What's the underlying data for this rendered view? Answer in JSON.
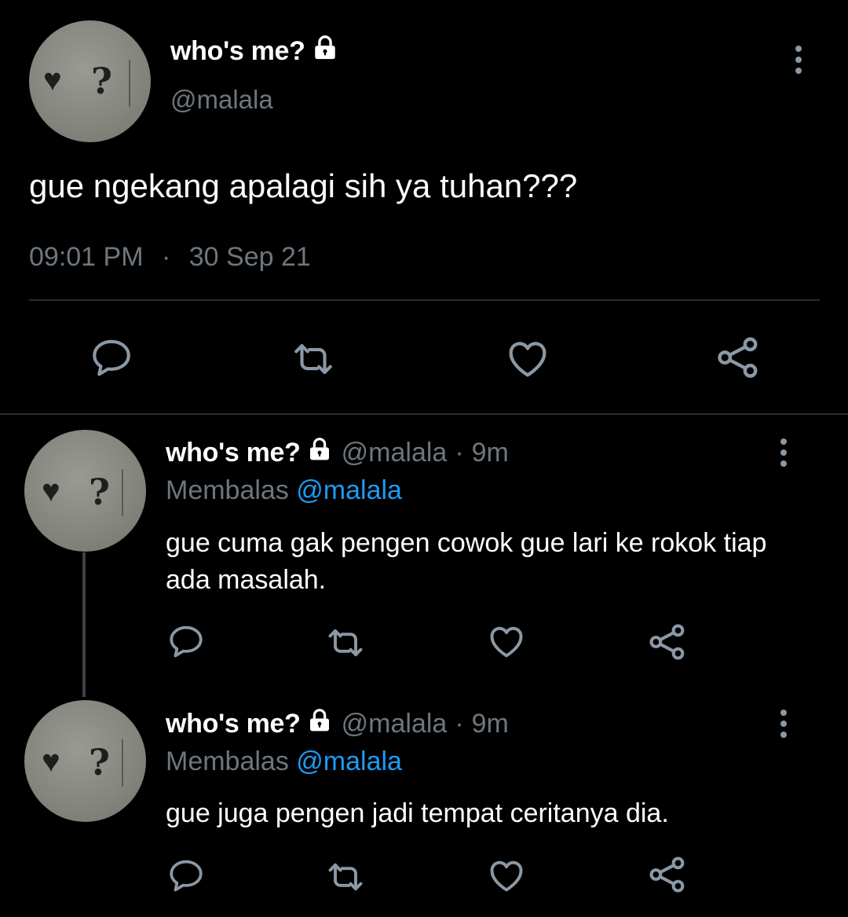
{
  "main_tweet": {
    "display_name": "who's me?",
    "handle": "@malala",
    "text": "gue ngekang apalagi sih ya tuhan???",
    "time": "09:01 PM",
    "separator": "·",
    "date": "30 Sep 21",
    "avatar_glyphs": {
      "heart": "♥",
      "question": "?"
    }
  },
  "replies": [
    {
      "display_name": "who's me?",
      "handle": "@malala",
      "dot": "·",
      "time": "9m",
      "replying_prefix": "Membalas",
      "replying_to": "@malala",
      "text": "gue cuma gak pengen cowok gue lari ke rokok tiap ada masalah."
    },
    {
      "display_name": "who's me?",
      "handle": "@malala",
      "dot": "·",
      "time": "9m",
      "replying_prefix": "Membalas",
      "replying_to": "@malala",
      "text": "gue juga pengen jadi tempat ceritanya dia."
    }
  ],
  "colors": {
    "background": "#000000",
    "primary_text": "#ffffff",
    "secondary_text": "#6e767d",
    "mention": "#1d9bf0",
    "icon": "#8b98a5",
    "divider": "#2a2d30"
  },
  "icons": {
    "lock": "lock-icon",
    "more": "more-vertical-icon",
    "reply": "reply-icon",
    "retweet": "retweet-icon",
    "like": "heart-icon",
    "share": "share-icon"
  }
}
